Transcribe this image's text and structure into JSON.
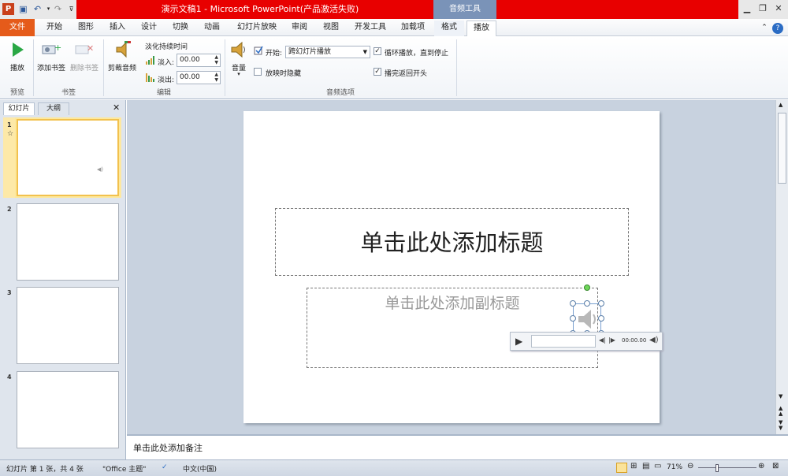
{
  "window": {
    "title": "演示文稿1  -  Microsoft PowerPoint(产品激活失败)",
    "context_tab_group": "音频工具"
  },
  "tabs": [
    {
      "label": "文件"
    },
    {
      "label": "开始"
    },
    {
      "label": "图形"
    },
    {
      "label": "插入"
    },
    {
      "label": "设计"
    },
    {
      "label": "切换"
    },
    {
      "label": "动画"
    },
    {
      "label": "幻灯片放映"
    },
    {
      "label": "审阅"
    },
    {
      "label": "视图"
    },
    {
      "label": "开发工具"
    },
    {
      "label": "加载项"
    },
    {
      "label": "格式"
    },
    {
      "label": "播放"
    }
  ],
  "ribbon": {
    "preview": {
      "play_label": "播放",
      "group_label": "预览"
    },
    "bookmarks": {
      "add_label": "添加书签",
      "remove_label": "删除书签",
      "group_label": "书签"
    },
    "editing": {
      "trim_label": "剪裁音频",
      "fade_duration_label": "淡化持续时间",
      "fade_in_label": "淡入:",
      "fade_in_value": "00.00",
      "fade_out_label": "淡出:",
      "fade_out_value": "00.00",
      "group_label": "编辑"
    },
    "audio_options": {
      "volume_label": "音量",
      "start_label": "开始:",
      "start_value": "跨幻灯片播放",
      "hide_label": "放映时隐藏",
      "loop_label": "循环播放，直到停止",
      "rewind_label": "播完返回开头",
      "hide_checked": false,
      "loop_checked": true,
      "rewind_checked": true,
      "group_label": "音频选项"
    }
  },
  "left_pane": {
    "tab_slides": "幻灯片",
    "tab_outline": "大纲",
    "close_glyph": "✕",
    "slides": [
      {
        "number": "1",
        "selected": true
      },
      {
        "number": "2",
        "selected": false
      },
      {
        "number": "3",
        "selected": false
      },
      {
        "number": "4",
        "selected": false
      }
    ],
    "transition_glyph": "☆"
  },
  "slide": {
    "title_placeholder": "单击此处添加标题",
    "subtitle_placeholder": "单击此处添加副标题",
    "audio_time": "00:00.00"
  },
  "notes": {
    "placeholder": "单击此处添加备注"
  },
  "status": {
    "slide_info": "幻灯片 第 1 张，共 4 张",
    "theme": "\"Office 主题\"",
    "language": "中文(中国)",
    "zoom": "71%"
  },
  "colors": {
    "title_bar": "#e80000",
    "file_tab": "#e55b1a",
    "context_group": "#7a93b8"
  }
}
